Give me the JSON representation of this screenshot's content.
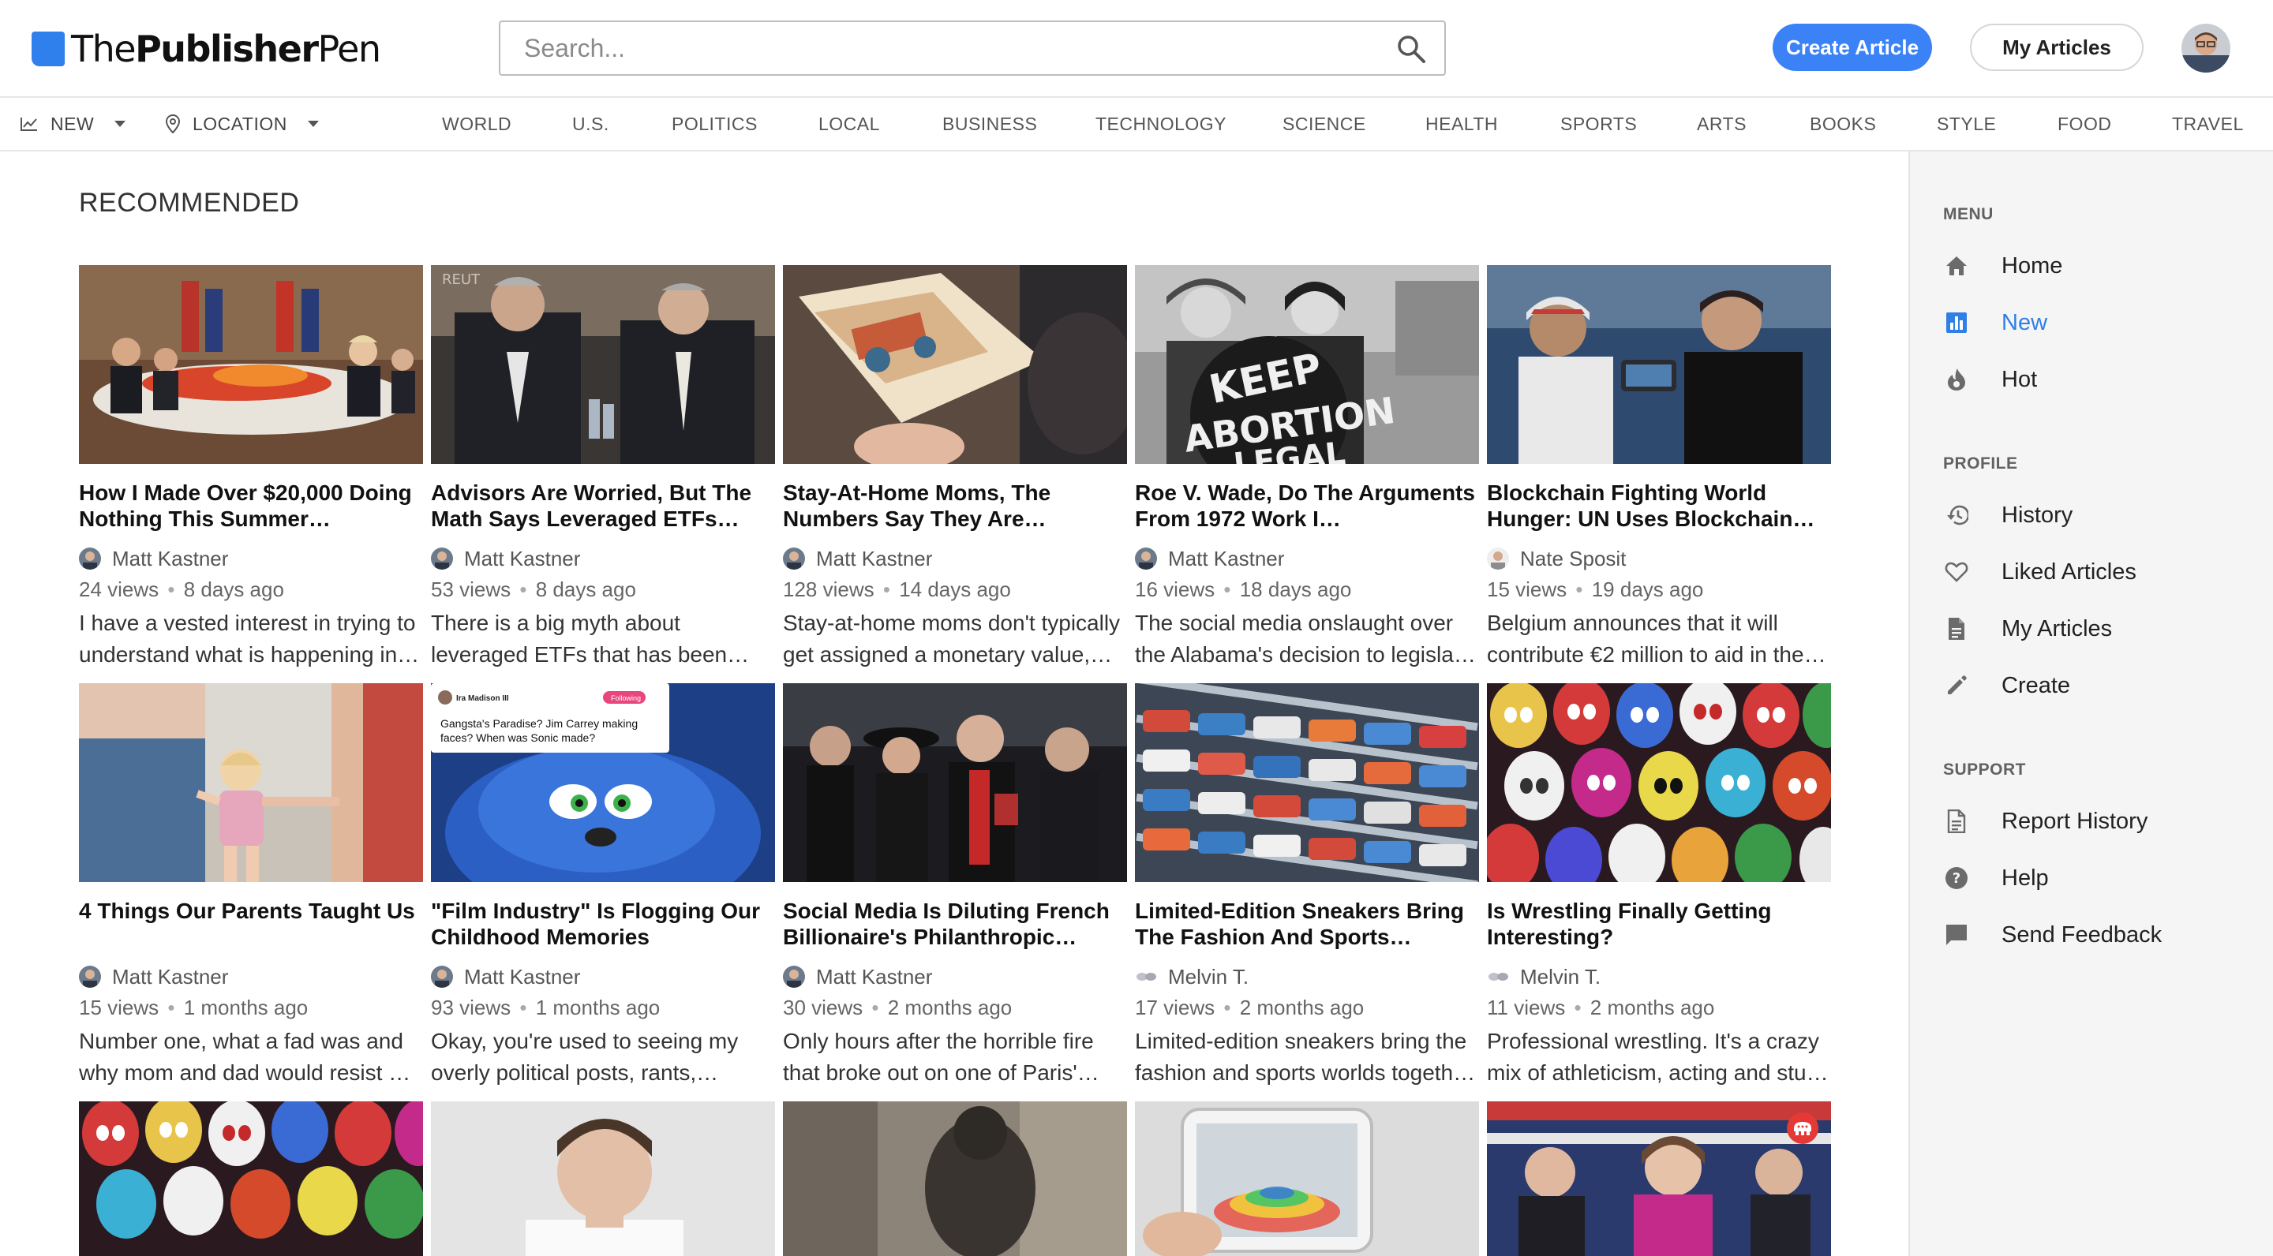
{
  "header": {
    "logo_part1": "The",
    "logo_part2": "Publisher",
    "logo_part3": "Pen",
    "search_placeholder": "Search...",
    "create_button": "Create Article",
    "my_articles_button": "My Articles"
  },
  "nav": {
    "filter_new": "NEW",
    "filter_location": "LOCATION",
    "categories": [
      "WORLD",
      "U.S.",
      "POLITICS",
      "LOCAL",
      "BUSINESS",
      "TECHNOLOGY",
      "SCIENCE",
      "HEALTH",
      "SPORTS",
      "ARTS",
      "BOOKS",
      "STYLE",
      "FOOD",
      "TRAVEL"
    ]
  },
  "main": {
    "section_title": "RECOMMENDED",
    "cards": [
      {
        "title": "How I Made Over $20,000 Doing Nothing This Summer…",
        "author": "Matt Kastner",
        "views": "24 views",
        "age": "8 days ago",
        "excerpt1": "I have a vested interest in trying to",
        "excerpt2": "understand what is happening in…"
      },
      {
        "title": "Advisors Are Worried, But The Math Says Leveraged ETFs…",
        "author": "Matt Kastner",
        "views": "53 views",
        "age": "8 days ago",
        "excerpt1": "There is a big myth about",
        "excerpt2": "leveraged ETFs that has been…"
      },
      {
        "title": "Stay-At-Home Moms, The Numbers Say They Are…",
        "author": "Matt Kastner",
        "views": "128 views",
        "age": "14 days ago",
        "excerpt1": "Stay-at-home moms don't typically",
        "excerpt2": "get assigned a monetary value,…"
      },
      {
        "title": "Roe V. Wade, Do The Arguments From 1972 Work I…",
        "author": "Matt Kastner",
        "views": "16 views",
        "age": "18 days ago",
        "excerpt1": "The social media onslaught over",
        "excerpt2": "the Alabama's decision to legislat…"
      },
      {
        "title": "Blockchain Fighting World Hunger: UN Uses Blockchain…",
        "author": "Nate Sposit",
        "views": "15 views",
        "age": "19 days ago",
        "excerpt1": "Belgium announces that it will",
        "excerpt2": "contribute €2 million to aid in the…"
      },
      {
        "title": "4 Things Our Parents Taught Us",
        "author": "Matt Kastner",
        "views": "15 views",
        "age": "1 months ago",
        "excerpt1": "Number one, what a fad was and",
        "excerpt2": "why mom and dad would resist …"
      },
      {
        "title": "\"Film Industry\" Is Flogging Our Childhood Memories",
        "author": "Matt Kastner",
        "views": "93 views",
        "age": "1 months ago",
        "excerpt1": "Okay, you're used to seeing my",
        "excerpt2": "overly political posts, rants,…"
      },
      {
        "title": "Social Media Is Diluting French Billionaire's Philanthropic…",
        "author": "Matt Kastner",
        "views": "30 views",
        "age": "2 months ago",
        "excerpt1": "Only hours after the horrible fire",
        "excerpt2": "that broke out on one of Paris'…"
      },
      {
        "title": "Limited-Edition Sneakers Bring The Fashion And Sports…",
        "author": "Melvin T.",
        "views": "17 views",
        "age": "2 months ago",
        "excerpt1": "Limited-edition sneakers bring the",
        "excerpt2": "fashion and sports worlds togeth…"
      },
      {
        "title": "Is Wrestling Finally Getting Interesting?",
        "author": "Melvin T.",
        "views": "11 views",
        "age": "2 months ago",
        "excerpt1": "Professional wrestling. It's a crazy",
        "excerpt2": "mix of athleticism, acting and stu…"
      }
    ],
    "tweet_user": "Ira Madison III",
    "tweet_badge": "Following",
    "tweet_text1": "Gangsta's Paradise? Jim Carrey making",
    "tweet_text2": "faces? When was Sonic made?",
    "poster_line1": "KEEP",
    "poster_line2": "ABORTION",
    "poster_line3": "LEGAL"
  },
  "sidebar": {
    "menu_head": "MENU",
    "menu": [
      {
        "label": "Home",
        "icon": "home-icon"
      },
      {
        "label": "New",
        "icon": "bar-chart-icon",
        "active": true
      },
      {
        "label": "Hot",
        "icon": "flame-icon"
      }
    ],
    "profile_head": "PROFILE",
    "profile": [
      {
        "label": "History",
        "icon": "history-icon"
      },
      {
        "label": "Liked Articles",
        "icon": "heart-icon"
      },
      {
        "label": "My Articles",
        "icon": "document-icon"
      },
      {
        "label": "Create",
        "icon": "pencil-icon"
      }
    ],
    "support_head": "SUPPORT",
    "support": [
      {
        "label": "Report History",
        "icon": "report-icon"
      },
      {
        "label": "Help",
        "icon": "help-icon"
      },
      {
        "label": "Send Feedback",
        "icon": "feedback-icon"
      }
    ]
  },
  "colors": {
    "accent": "#3b82f6",
    "active_nav": "#2f7fe6",
    "sidebar_bg": "#f5f5f5"
  }
}
